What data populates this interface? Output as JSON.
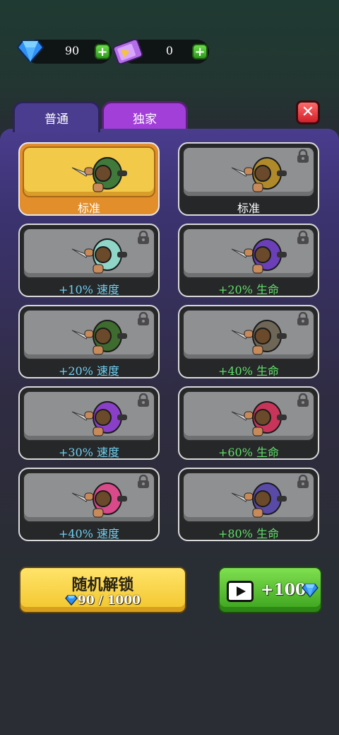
{
  "currency": {
    "gems": {
      "icon": "diamond-icon",
      "value": "90",
      "plus": "+"
    },
    "tickets": {
      "icon": "ticket-icon",
      "value": "0",
      "plus": "+"
    }
  },
  "tabs": [
    {
      "label": "普通",
      "selected": true
    },
    {
      "label": "独家",
      "selected": false
    }
  ],
  "close_label": "✕",
  "colors": {
    "speed": "#6fd0f2",
    "health": "#5fe06a",
    "panel": "#4a3c8e",
    "selected": "#f3c94a"
  },
  "characters": [
    {
      "label": "标准",
      "locked": false,
      "selected": true,
      "label_color": "#ffffff",
      "outfit": "#3f7a3a"
    },
    {
      "label": "标准",
      "locked": true,
      "selected": false,
      "label_color": "#ffffff",
      "outfit": "#b08a2a"
    },
    {
      "label": "+10% 速度",
      "locked": true,
      "selected": false,
      "label_color": "#6fd0f2",
      "outfit": "#8fd6c8"
    },
    {
      "label": "+20% 生命",
      "locked": true,
      "selected": false,
      "label_color": "#5fe06a",
      "outfit": "#6a3fb8"
    },
    {
      "label": "+20% 速度",
      "locked": true,
      "selected": false,
      "label_color": "#6fd0f2",
      "outfit": "#3e6b2e"
    },
    {
      "label": "+40% 生命",
      "locked": true,
      "selected": false,
      "label_color": "#5fe06a",
      "outfit": "#6e6656"
    },
    {
      "label": "+30% 速度",
      "locked": true,
      "selected": false,
      "label_color": "#6fd0f2",
      "outfit": "#8a3fc8"
    },
    {
      "label": "+60% 生命",
      "locked": true,
      "selected": false,
      "label_color": "#5fe06a",
      "outfit": "#c8345a"
    },
    {
      "label": "+40% 速度",
      "locked": true,
      "selected": false,
      "label_color": "#6fd0f2",
      "outfit": "#d84a8a"
    },
    {
      "label": "+80% 生命",
      "locked": true,
      "selected": false,
      "label_color": "#5fe06a",
      "outfit": "#5a4aa8"
    }
  ],
  "random_unlock": {
    "title": "随机解锁",
    "cost": "90 / 1000"
  },
  "video_reward": {
    "label": "+100"
  }
}
